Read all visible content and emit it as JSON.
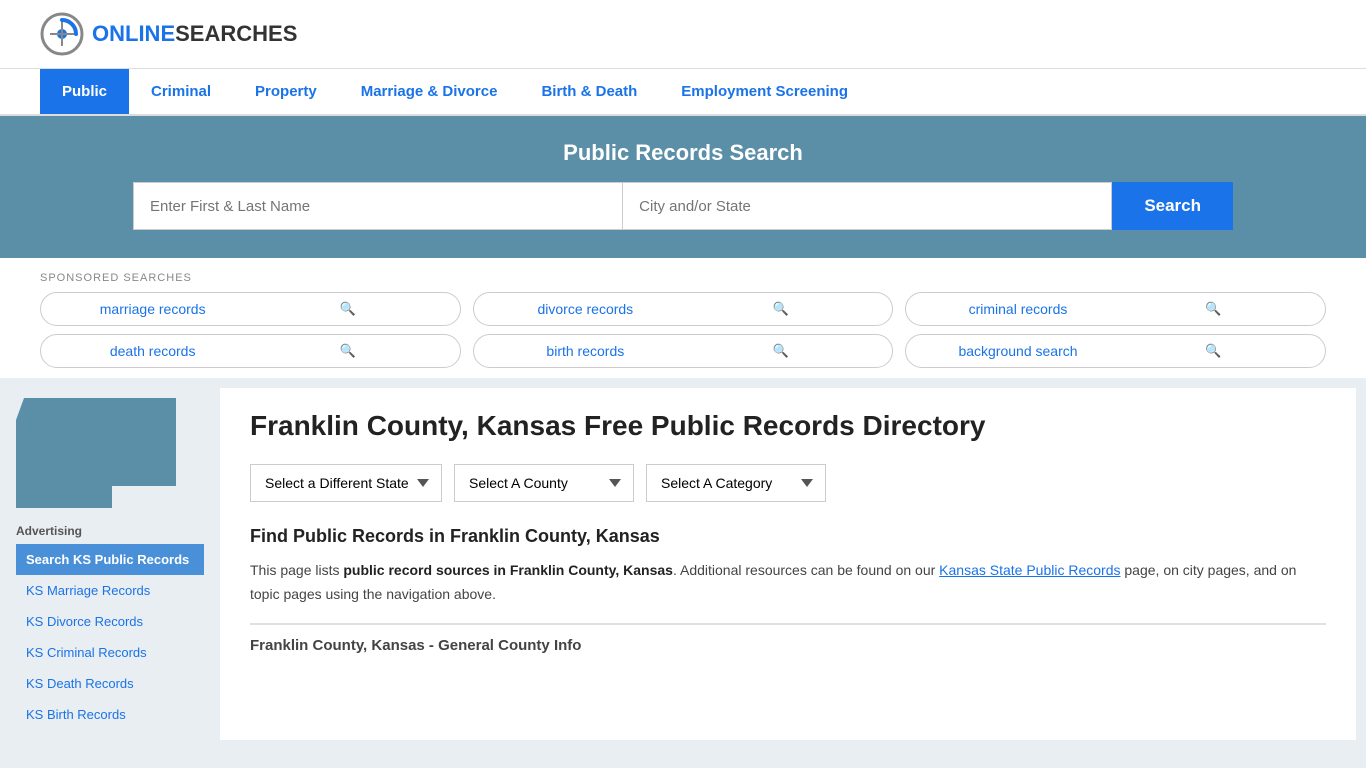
{
  "header": {
    "logo_brand": "ONLINE",
    "logo_brand2": "SEARCHES"
  },
  "nav": {
    "items": [
      {
        "label": "Public",
        "active": true
      },
      {
        "label": "Criminal",
        "active": false
      },
      {
        "label": "Property",
        "active": false
      },
      {
        "label": "Marriage & Divorce",
        "active": false
      },
      {
        "label": "Birth & Death",
        "active": false
      },
      {
        "label": "Employment Screening",
        "active": false
      }
    ]
  },
  "hero": {
    "title": "Public Records Search",
    "name_placeholder": "Enter First & Last Name",
    "location_placeholder": "City and/or State",
    "search_label": "Search"
  },
  "sponsored": {
    "label": "SPONSORED SEARCHES",
    "items": [
      {
        "text": "marriage records"
      },
      {
        "text": "divorce records"
      },
      {
        "text": "criminal records"
      },
      {
        "text": "death records"
      },
      {
        "text": "birth records"
      },
      {
        "text": "background search"
      }
    ]
  },
  "sidebar": {
    "ad_label": "Advertising",
    "links": [
      {
        "text": "Search KS Public Records",
        "highlighted": true
      },
      {
        "text": "KS Marriage Records",
        "highlighted": false
      },
      {
        "text": "KS Divorce Records",
        "highlighted": false
      },
      {
        "text": "KS Criminal Records",
        "highlighted": false
      },
      {
        "text": "KS Death Records",
        "highlighted": false
      },
      {
        "text": "KS Birth Records",
        "highlighted": false
      }
    ]
  },
  "directory": {
    "page_title": "Franklin County, Kansas Free Public Records Directory",
    "dropdowns": {
      "state_label": "Select a Different State",
      "county_label": "Select A County",
      "category_label": "Select A Category"
    },
    "find_records_title": "Find Public Records in Franklin County, Kansas",
    "description_part1": "This page lists ",
    "description_bold": "public record sources in Franklin County, Kansas",
    "description_part2": ". Additional resources can be found on our ",
    "description_link": "Kansas State Public Records",
    "description_part3": " page, on city pages, and on topic pages using the navigation above.",
    "general_info_title": "Franklin County, Kansas - General County Info"
  }
}
